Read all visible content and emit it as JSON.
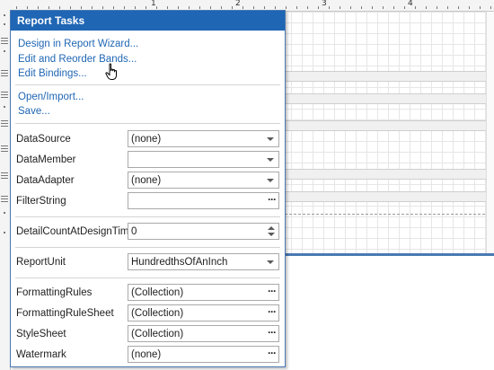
{
  "ruler": {
    "numbers": [
      "1",
      "2",
      "3",
      "4"
    ]
  },
  "panel": {
    "title": "Report Tasks",
    "links_top": [
      "Design in Report Wizard...",
      "Edit and Reorder Bands...",
      "Edit Bindings..."
    ],
    "links_file": [
      "Open/Import...",
      "Save..."
    ],
    "properties": {
      "datasource": {
        "label": "DataSource",
        "value": "(none)",
        "editor": "dropdown"
      },
      "datamember": {
        "label": "DataMember",
        "value": "",
        "editor": "dropdown"
      },
      "dataadapter": {
        "label": "DataAdapter",
        "value": "(none)",
        "editor": "dropdown"
      },
      "filterstring": {
        "label": "FilterString",
        "value": "",
        "editor": "ellipsis"
      },
      "detailcount": {
        "label": "DetailCountAtDesignTime",
        "value": "0",
        "editor": "spin"
      },
      "reportunit": {
        "label": "ReportUnit",
        "value": "HundredthsOfAnInch",
        "editor": "dropdown"
      },
      "formattingrules": {
        "label": "FormattingRules",
        "value": "(Collection)",
        "editor": "ellipsis"
      },
      "formattingrulesheet": {
        "label": "FormattingRuleSheet",
        "value": "(Collection)",
        "editor": "ellipsis"
      },
      "stylesheet": {
        "label": "StyleSheet",
        "value": "(Collection)",
        "editor": "ellipsis"
      },
      "watermark": {
        "label": "Watermark",
        "value": "(none)",
        "editor": "ellipsis"
      }
    },
    "ellipsis_glyph": "···"
  },
  "colors": {
    "header_bg": "#1f66b4",
    "link": "#1f66b4",
    "page_edge": "#4a79b3"
  },
  "icons": [
    "hand-cursor-icon",
    "dropdown-arrow-icon",
    "ellipsis-icon",
    "spin-up-icon",
    "spin-down-icon"
  ]
}
